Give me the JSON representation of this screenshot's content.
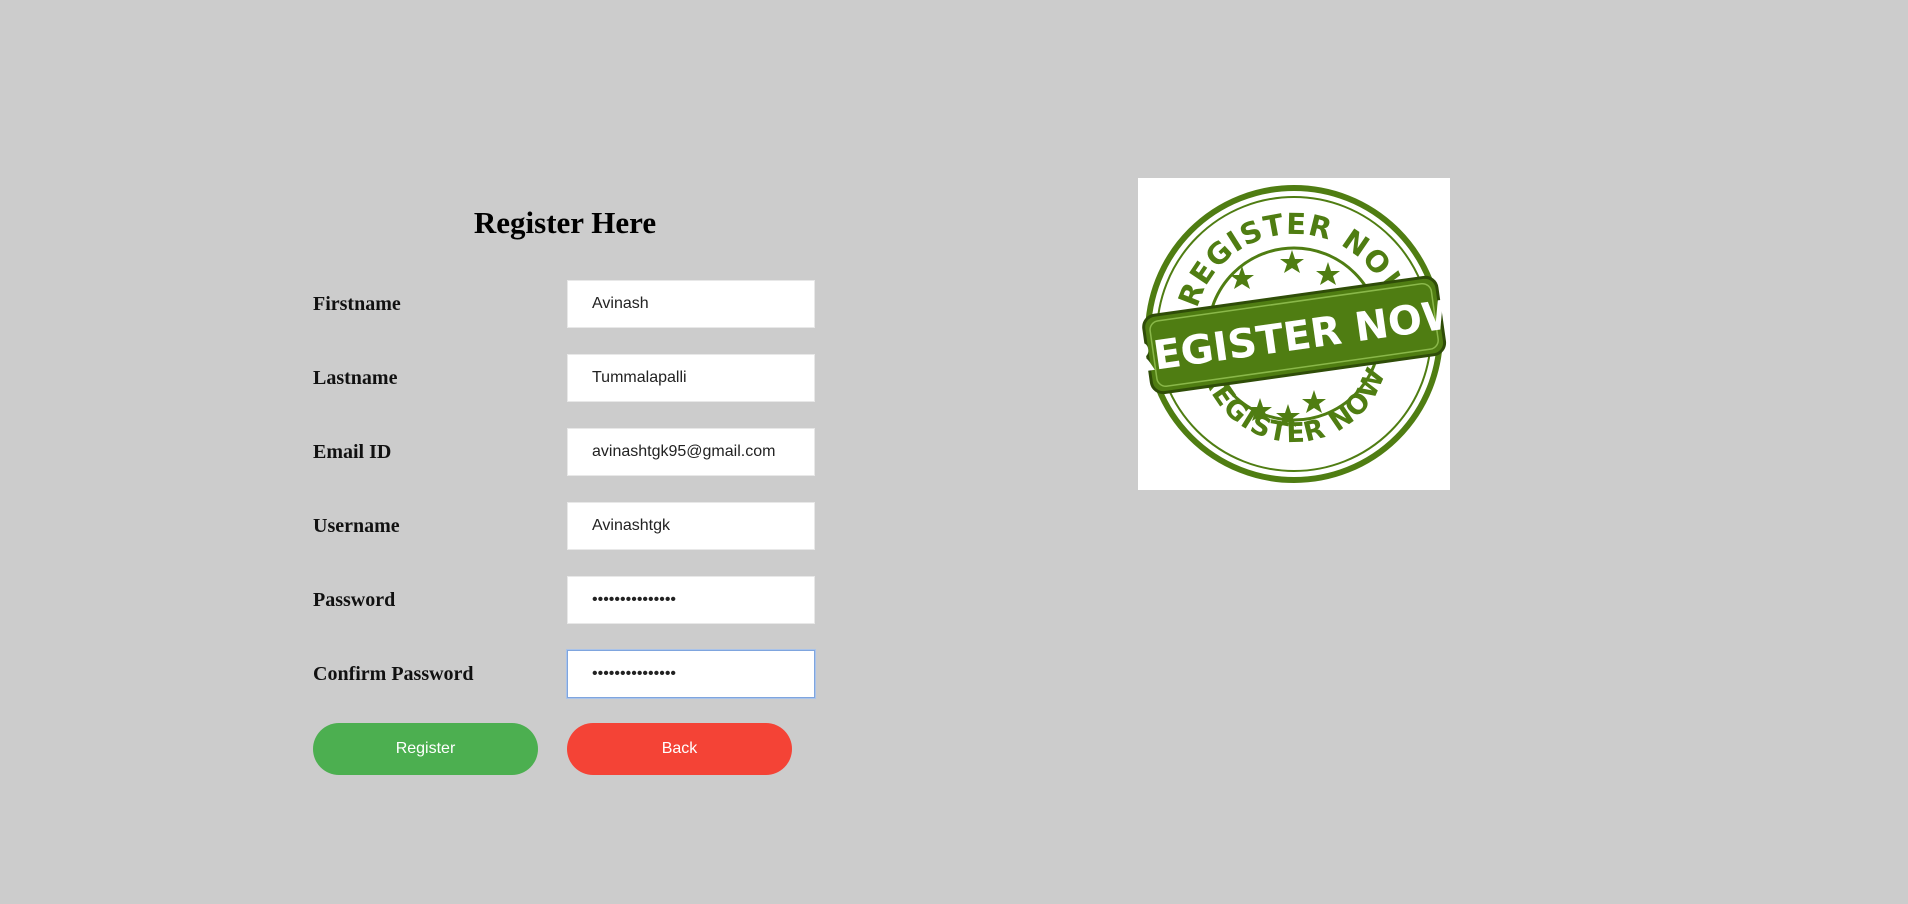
{
  "form": {
    "title": "Register Here",
    "fields": [
      {
        "label": "Firstname",
        "value": "Avinash",
        "type": "text"
      },
      {
        "label": "Lastname",
        "value": "Tummalapalli",
        "type": "text"
      },
      {
        "label": "Email ID",
        "value": "avinashtgk95@gmail.com",
        "type": "text"
      },
      {
        "label": "Username",
        "value": "Avinashtgk",
        "type": "text"
      },
      {
        "label": "Password",
        "value": "passwordvalue12",
        "type": "password"
      },
      {
        "label": "Confirm Password",
        "value": "passwordvalue12",
        "type": "password"
      }
    ],
    "register_label": "Register",
    "back_label": "Back"
  },
  "badge": {
    "top_arc_text": "REGISTER NOW",
    "banner_text": "REGISTER NOW",
    "bottom_arc_text": "REGISTER NOW",
    "color": "#4f7d12"
  },
  "colors": {
    "background": "#cccccc",
    "register_button": "#4caf50",
    "back_button": "#f44336"
  }
}
